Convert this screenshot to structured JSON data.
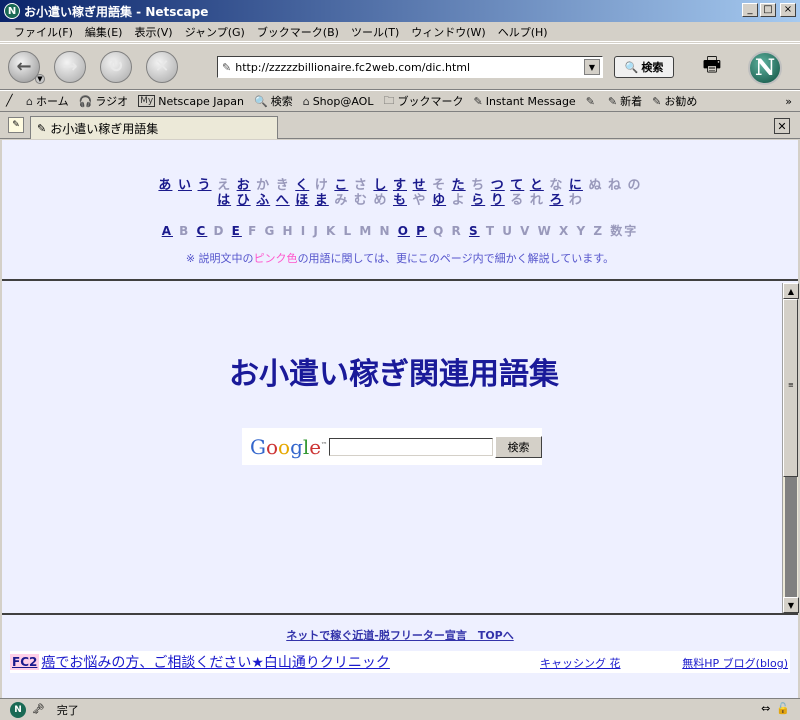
{
  "window": {
    "title": "お小遣い稼ぎ用語集 - Netscape",
    "app_icon": "netscape-n",
    "minimize": "_",
    "maximize": "□",
    "close": "×"
  },
  "menu": [
    "ファイル(F)",
    "編集(E)",
    "表示(V)",
    "ジャンプ(G)",
    "ブックマーク(B)",
    "ツール(T)",
    "ウィンドウ(W)",
    "ヘルプ(H)"
  ],
  "nav": {
    "url": "http://zzzzzbillionaire.fc2web.com/dic.html",
    "search_label": "検索",
    "netscape_logo": "N"
  },
  "personal_toolbar": {
    "items": [
      {
        "icon": "home-icon",
        "label": "ホーム"
      },
      {
        "icon": "headphones-icon",
        "label": "ラジオ"
      },
      {
        "icon": "my-icon",
        "label": "Netscape Japan"
      },
      {
        "icon": "search-icon",
        "label": "検索"
      },
      {
        "icon": "aol-icon",
        "label": "Shop@AOL"
      },
      {
        "icon": "folder-icon",
        "label": "ブックマーク"
      },
      {
        "icon": "link-icon",
        "label": "Instant Message"
      },
      {
        "icon": "link-icon",
        "label": ""
      },
      {
        "icon": "link-icon",
        "label": "新着"
      },
      {
        "icon": "link-icon",
        "label": "お勧め"
      }
    ],
    "more": "»"
  },
  "tab": {
    "title": "お小遣い稼ぎ用語集"
  },
  "index": {
    "kana_row1": [
      {
        "t": "あ",
        "link": true
      },
      {
        "t": "い",
        "link": true
      },
      {
        "t": "う",
        "link": true
      },
      {
        "t": "え",
        "link": false
      },
      {
        "t": "お",
        "link": true
      },
      {
        "t": "か",
        "link": false
      },
      {
        "t": "き",
        "link": false
      },
      {
        "t": "く",
        "link": true
      },
      {
        "t": "け",
        "link": false
      },
      {
        "t": "こ",
        "link": true
      },
      {
        "t": "さ",
        "link": false
      },
      {
        "t": "し",
        "link": true
      },
      {
        "t": "す",
        "link": true
      },
      {
        "t": "せ",
        "link": true
      },
      {
        "t": "そ",
        "link": false
      },
      {
        "t": "た",
        "link": true
      },
      {
        "t": "ち",
        "link": false
      },
      {
        "t": "つ",
        "link": true
      },
      {
        "t": "て",
        "link": true
      },
      {
        "t": "と",
        "link": true
      },
      {
        "t": "な",
        "link": false
      },
      {
        "t": "に",
        "link": true
      },
      {
        "t": "ぬ",
        "link": false
      },
      {
        "t": "ね",
        "link": false
      },
      {
        "t": "の",
        "link": false
      }
    ],
    "kana_row2": [
      {
        "t": "は",
        "link": true
      },
      {
        "t": "ひ",
        "link": true
      },
      {
        "t": "ふ",
        "link": true
      },
      {
        "t": "へ",
        "link": true
      },
      {
        "t": "ほ",
        "link": true
      },
      {
        "t": "ま",
        "link": true
      },
      {
        "t": "み",
        "link": false
      },
      {
        "t": "む",
        "link": false
      },
      {
        "t": "め",
        "link": false
      },
      {
        "t": "も",
        "link": true
      },
      {
        "t": "や",
        "link": false
      },
      {
        "t": "ゆ",
        "link": true
      },
      {
        "t": "よ",
        "link": false
      },
      {
        "t": "ら",
        "link": true
      },
      {
        "t": "り",
        "link": true
      },
      {
        "t": "る",
        "link": false
      },
      {
        "t": "れ",
        "link": false
      },
      {
        "t": "ろ",
        "link": true
      },
      {
        "t": "わ",
        "link": false
      }
    ],
    "alpha": [
      {
        "t": "A",
        "link": true
      },
      {
        "t": "B",
        "link": false
      },
      {
        "t": "C",
        "link": true
      },
      {
        "t": "D",
        "link": false
      },
      {
        "t": "E",
        "link": true
      },
      {
        "t": "F",
        "link": false
      },
      {
        "t": "G",
        "link": false
      },
      {
        "t": "H",
        "link": false
      },
      {
        "t": "I",
        "link": false
      },
      {
        "t": "J",
        "link": false
      },
      {
        "t": "K",
        "link": false
      },
      {
        "t": "L",
        "link": false
      },
      {
        "t": "M",
        "link": false
      },
      {
        "t": "N",
        "link": false
      },
      {
        "t": "O",
        "link": true
      },
      {
        "t": "P",
        "link": true
      },
      {
        "t": "Q",
        "link": false
      },
      {
        "t": "R",
        "link": false
      },
      {
        "t": "S",
        "link": true
      },
      {
        "t": "T",
        "link": false
      },
      {
        "t": "U",
        "link": false
      },
      {
        "t": "V",
        "link": false
      },
      {
        "t": "W",
        "link": false
      },
      {
        "t": "X",
        "link": false
      },
      {
        "t": "Y",
        "link": false
      },
      {
        "t": "Z",
        "link": false
      },
      {
        "t": "数字",
        "link": false
      }
    ],
    "note_prefix": "※ 説明文中の",
    "note_pink": "ピンク色",
    "note_suffix": "の用語に関しては、更にこのページ内で細かく解説しています。"
  },
  "main": {
    "title": "お小遣い稼ぎ関連用語集",
    "google_search_button": "検索"
  },
  "footer": {
    "top_link": "ネットで稼ぐ近道-脱フリーター宣言　TOPへ",
    "fc2": "FC2",
    "ad_text": "癌でお悩みの方、ご相談ください★白山通りクリニック",
    "ad_links": "キャッシング 花",
    "ad_links2": "無料HP ブログ(blog)"
  },
  "status": {
    "text": "完了"
  }
}
